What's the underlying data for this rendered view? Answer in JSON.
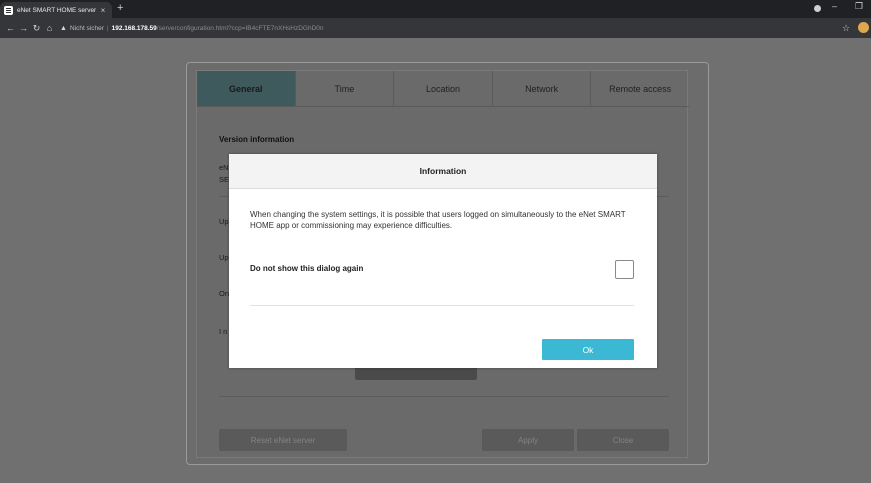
{
  "browser": {
    "tab_title": "eNet SMART HOME server",
    "tab_close": "×",
    "new_tab": "+",
    "address": {
      "security_label": "Nicht sicher",
      "host": "192.168.178.59",
      "path": "/serverconfiguration.html?ccp=IB4cFTE7nXHsHzDGhD0n"
    }
  },
  "config": {
    "tabs": [
      "General",
      "Time",
      "Location",
      "Network",
      "Remote access"
    ],
    "active_tab": "General",
    "section_title": "Version information",
    "behind_text": [
      "eN",
      "SE",
      "Up",
      "Up",
      "On",
      "I n"
    ],
    "reset_label": "Reset eNet server",
    "apply_label": "Apply",
    "close_label": "Close"
  },
  "dialog": {
    "title": "Information",
    "message": "When changing the system settings, it is possible that users logged on simultaneously to the eNet SMART HOME app or commissioning may experience difficulties.",
    "checkbox_label": "Do not show this dialog again",
    "ok_label": "Ok"
  },
  "colors": {
    "ok_button": "#3bb9d4",
    "active_tab": "#3e5a5c",
    "overlay": "#707070"
  }
}
